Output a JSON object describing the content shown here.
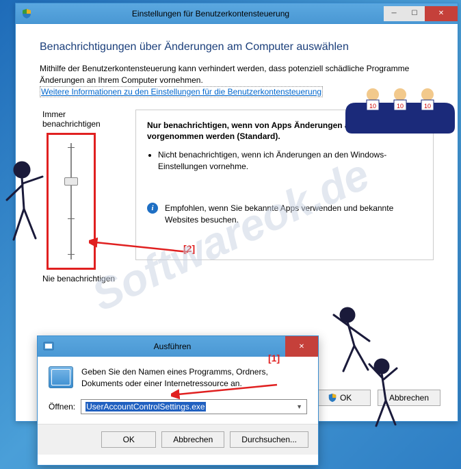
{
  "uac": {
    "title": "Einstellungen für Benutzerkontensteuerung",
    "heading": "Benachrichtigungen über Änderungen am Computer auswählen",
    "desc": "Mithilfe der Benutzerkontensteuerung kann verhindert werden, dass potenziell schädliche Programme Änderungen an Ihrem Computer vornehmen.",
    "link": "Weitere Informationen zu den Einstellungen für die Benutzerkontensteuerung",
    "slider_top_label": "Immer benachrichtigen",
    "slider_bottom_label": "Nie benachrichtigen",
    "info_title": "Nur benachrichtigen, wenn von Apps Änderungen am Computer vorgenommen werden (Standard).",
    "info_bullet": "Nicht benachrichtigen, wenn ich Änderungen an den Windows-Einstellungen vornehme.",
    "info_recommend": "Empfohlen, wenn Sie bekannte Apps verwenden und bekannte Websites besuchen.",
    "ok_label": "OK",
    "cancel_label": "Abbrechen"
  },
  "run": {
    "title": "Ausführen",
    "desc": "Geben Sie den Namen eines Programms, Ordners, Dokuments oder einer Internetressource an.",
    "open_label": "Öffnen:",
    "input_value": "UserAccountControlSettings.exe",
    "ok_label": "OK",
    "cancel_label": "Abbrechen",
    "browse_label": "Durchsuchen..."
  },
  "annotations": {
    "marker1": "[1]",
    "marker2": "[2]"
  },
  "watermark": "Softwareok.de"
}
